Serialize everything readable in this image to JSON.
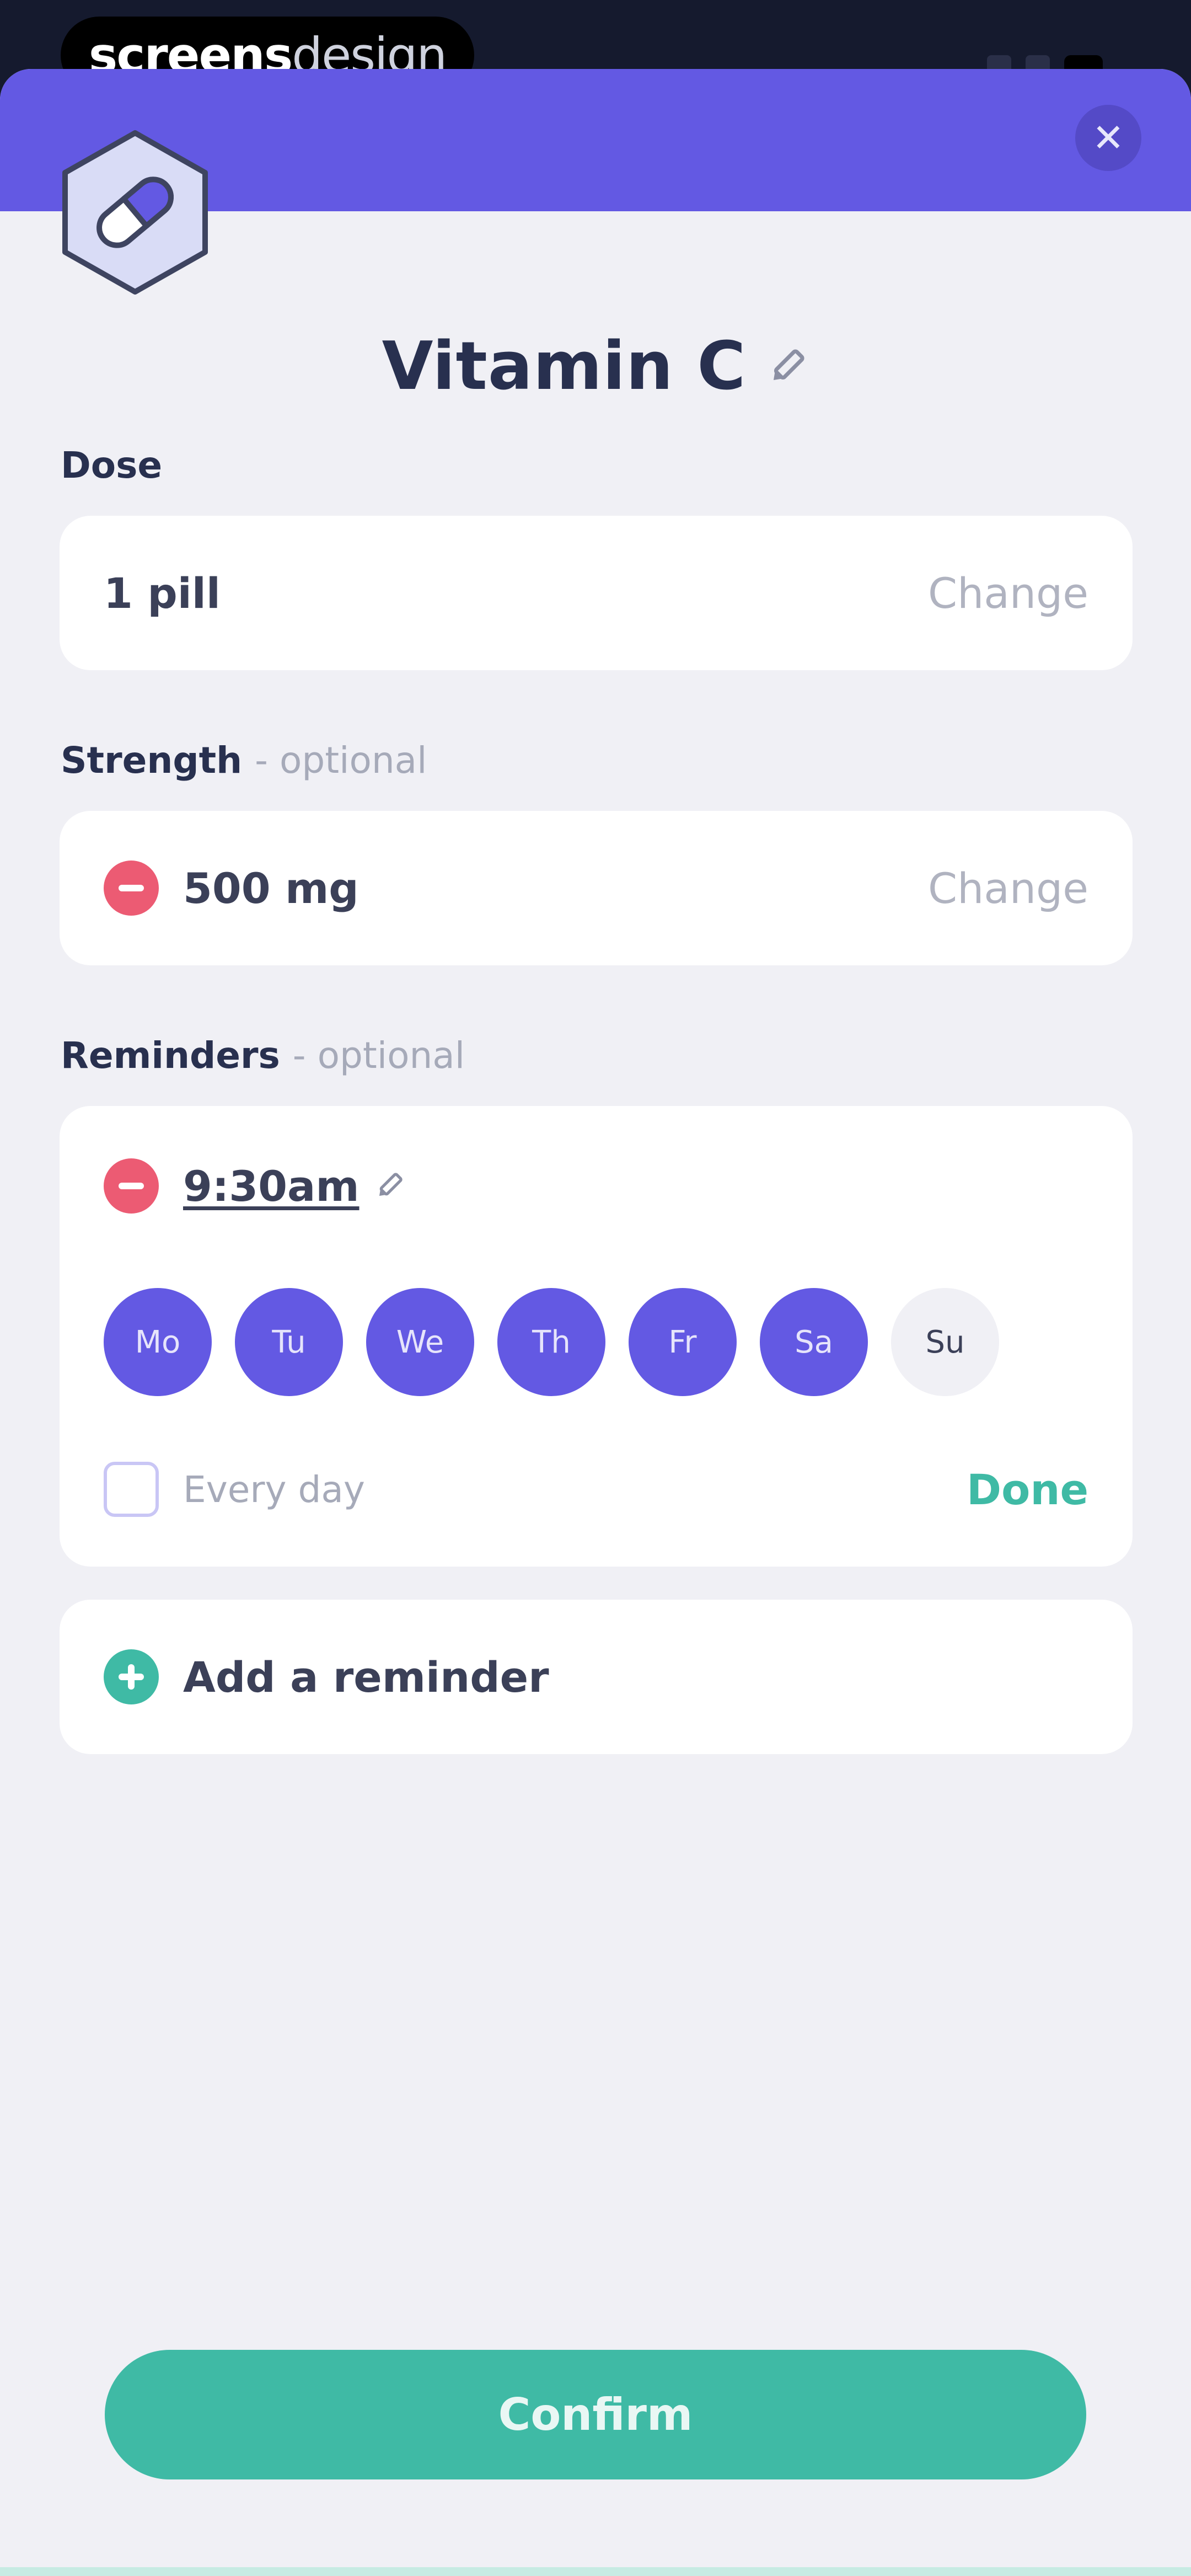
{
  "watermark": {
    "bold": "screens",
    "light": "design"
  },
  "header": {
    "close_icon": "close-icon"
  },
  "medication": {
    "name": "Vitamin C",
    "icon": "pill-icon"
  },
  "dose": {
    "label": "Dose",
    "value": "1 pill",
    "action": "Change"
  },
  "strength": {
    "label": "Strength",
    "optional": "- optional",
    "value": "500 mg",
    "action": "Change"
  },
  "reminders": {
    "label": "Reminders",
    "optional": "- optional",
    "items": [
      {
        "time": "9:30am",
        "days": [
          {
            "label": "Mo",
            "selected": true
          },
          {
            "label": "Tu",
            "selected": true
          },
          {
            "label": "We",
            "selected": true
          },
          {
            "label": "Th",
            "selected": true
          },
          {
            "label": "Fr",
            "selected": true
          },
          {
            "label": "Sa",
            "selected": true
          },
          {
            "label": "Su",
            "selected": false
          }
        ],
        "every_day_label": "Every day",
        "every_day_checked": false,
        "done_label": "Done"
      }
    ],
    "add_label": "Add a reminder"
  },
  "confirm_label": "Confirm",
  "colors": {
    "header": "#6359e3",
    "accent_green": "#3fbaa5",
    "remove_red": "#ec5b73",
    "title_text": "#28304f"
  }
}
